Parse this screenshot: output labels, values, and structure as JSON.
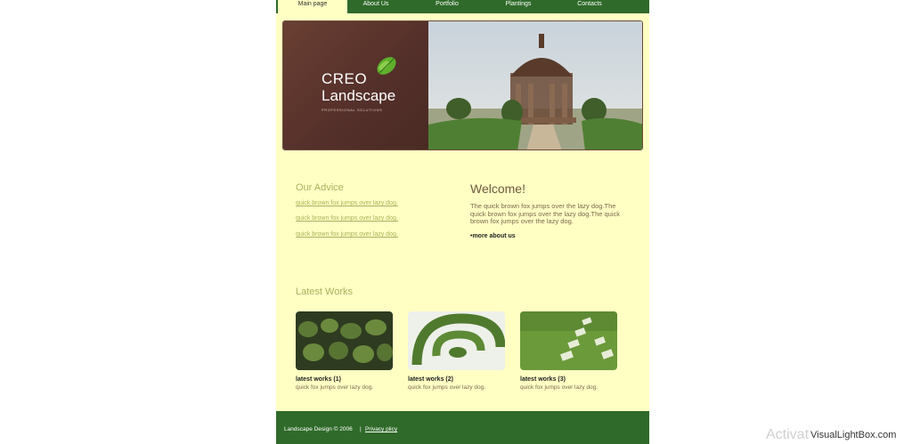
{
  "nav": {
    "items": [
      {
        "label": "Main page"
      },
      {
        "label": "About Us"
      },
      {
        "label": "Portfolio"
      },
      {
        "label": "Plantings"
      },
      {
        "label": "Contacts"
      }
    ]
  },
  "banner": {
    "logo_line1": "CREO",
    "logo_line2": "Landscape",
    "logo_tagline": "PROFESSIONAL SOLUTIONS"
  },
  "advice": {
    "title": "Our Advice",
    "links": [
      "quick brown fox jumps over lazy dog.",
      "quick brown fox jumps over lazy dog.",
      "quick brown fox jumps over lazy dog."
    ]
  },
  "welcome": {
    "title": "Welcome!",
    "text": "The quick brown fox jumps over the lazy dog.The quick brown fox jumps over the lazy dog.The quick brown fox jumps over the lazy dog.",
    "more": "•more about us"
  },
  "works": {
    "title": "Latest Works",
    "items": [
      {
        "title": "latest works (1)",
        "desc": "quick fox jumps over lazy dog."
      },
      {
        "title": "latest works (2)",
        "desc": "quick fox jumps over lazy dog."
      },
      {
        "title": "latest works (3)",
        "desc": "quick fox jumps over lazy dog."
      }
    ]
  },
  "footer": {
    "copyright": "Landscape Design © 2006",
    "separator": "|",
    "privacy": "Privacy plicy"
  },
  "watermark": {
    "text": "Activat",
    "site": "VisualLightBox.com"
  },
  "colors": {
    "nav_green": "#2f6a2a",
    "page_bg": "#ffffc4",
    "accent_olive": "#a9b25a",
    "logo_brown": "#55302a"
  }
}
